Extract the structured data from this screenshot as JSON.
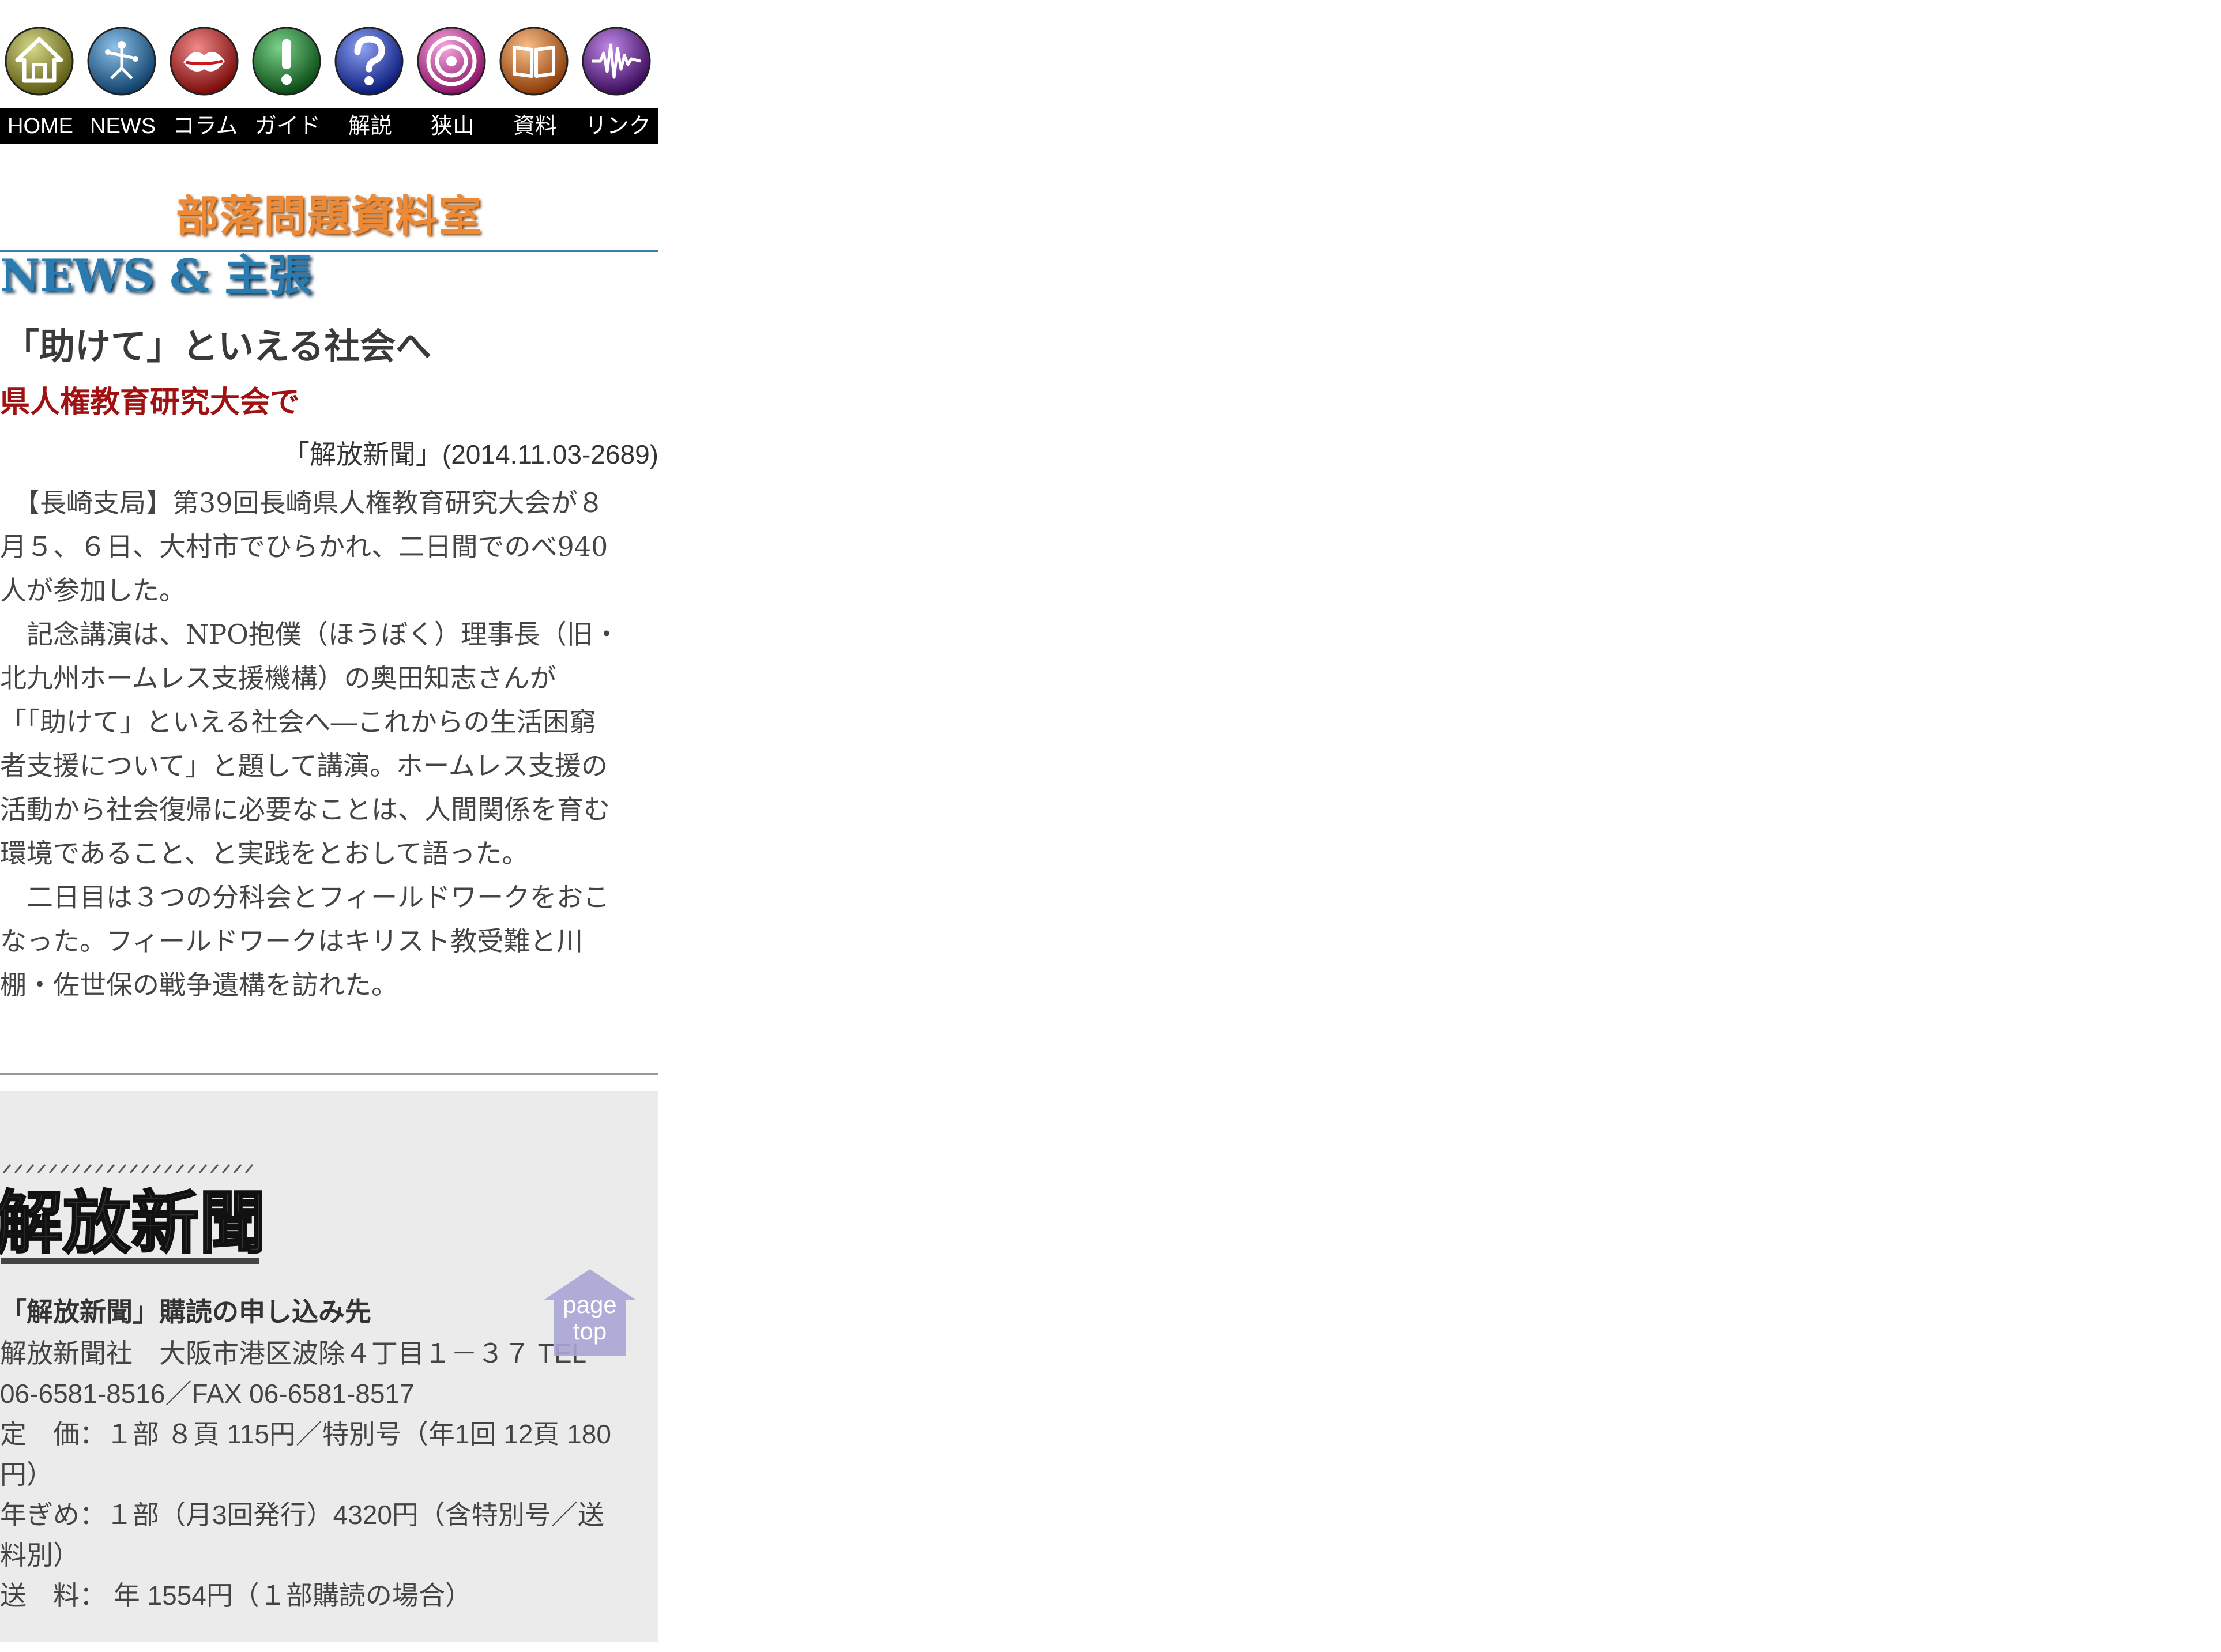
{
  "nav": {
    "icons": [
      {
        "name": "home-icon",
        "color": "#8a8a2a",
        "label": "HOME"
      },
      {
        "name": "news-icon",
        "color": "#1f6aa6",
        "label": "NEWS"
      },
      {
        "name": "column-icon",
        "color": "#c81a1a",
        "label": "コラム"
      },
      {
        "name": "guide-icon",
        "color": "#17792a",
        "label": "ガイド"
      },
      {
        "name": "help-icon",
        "color": "#1f3fc4",
        "label": "解説"
      },
      {
        "name": "target-icon",
        "color": "#d63fa8",
        "label": "狭山"
      },
      {
        "name": "book-icon",
        "color": "#e86a16",
        "label": "資料"
      },
      {
        "name": "waveform-icon",
        "color": "#6a1f9a",
        "label": "リンク"
      }
    ]
  },
  "site": {
    "title": "部落問題資料室",
    "section": "NEWS & 主張"
  },
  "article": {
    "title": "「助けて」といえる社会へ",
    "subtitle": "県人権教育研究大会で",
    "source": "「解放新聞」(2014.11.03-2689)",
    "lines": [
      "　【長崎支局】第39回長崎県人権教育研究大会が８",
      "月５、６日、大村市でひらかれ、二日間でのべ940",
      "人が参加した。",
      "　記念講演は、NPO抱僕（ほうぼく）理事長（旧・",
      "北九州ホームレス支援機構）の奥田知志さんが",
      "「「助けて」といえる社会へ―これからの生活困窮",
      "者支援について」と題して講演。ホームレス支援の",
      "活動から社会復帰に必要なことは、人間関係を育む",
      "環境であること、と実践をとおして語った。",
      "　二日目は３つの分科会とフィールドワークをおこ",
      "なった。フィールドワークはキリスト教受難と川",
      "棚・佐世保の戦争遺構を訪れた。"
    ]
  },
  "subscription": {
    "logo_text": "解放新聞",
    "heading": "「解放新聞」購読の申し込み先",
    "lines": [
      "解放新聞社　大阪市港区波除４丁目１－３７ TEL",
      "06-6581-8516／FAX 06-6581-8517",
      "定　価：１部 ８頁 115円／特別号（年1回 12頁 180",
      "円）",
      "年ぎめ：１部（月3回発行）4320円（含特別号／送",
      "料別）",
      "送　料： 年 1554円（１部購読の場合）"
    ]
  },
  "page_top": {
    "line1": "page",
    "line2": "top",
    "color": "#a9a6d6"
  }
}
